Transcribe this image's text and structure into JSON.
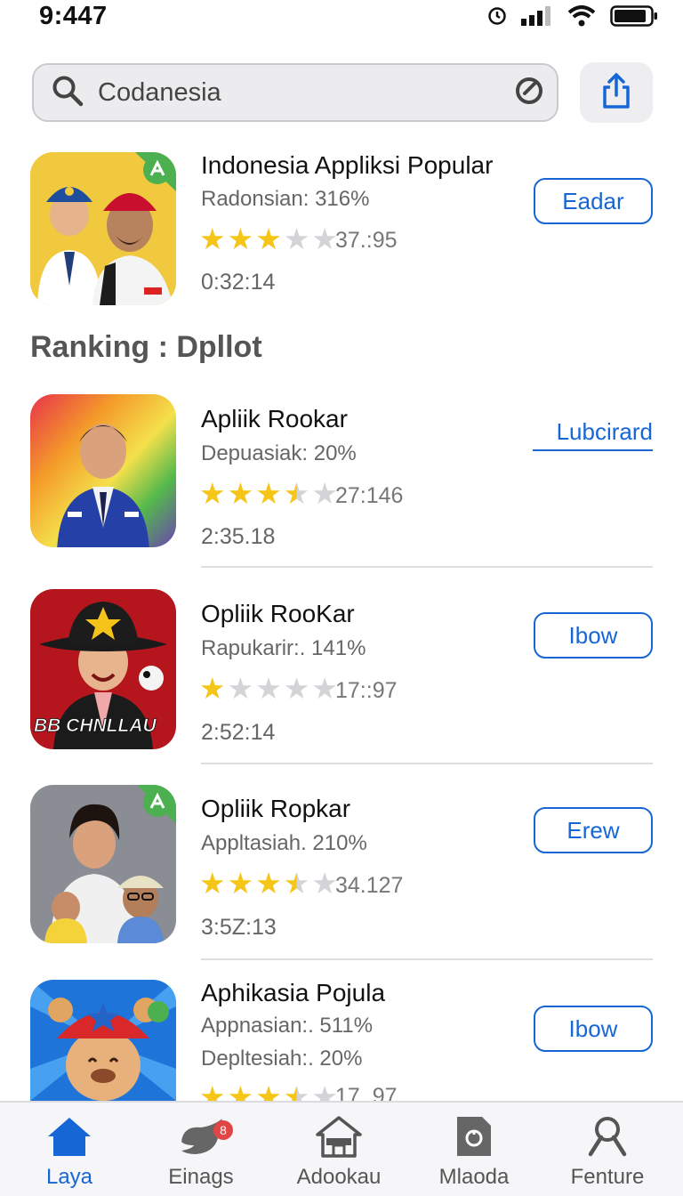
{
  "status_bar": {
    "time": "9:447"
  },
  "search": {
    "query": "Codanesia",
    "icon": "search-icon"
  },
  "featured": {
    "title": "Indonesia Appliksi Popular",
    "subtitle": "Radonsian: 316%",
    "rating_count": "37.:95",
    "time": "0:32:14",
    "stars": 3,
    "button": "Eadar"
  },
  "section": {
    "title": "Ranking  :  Dpllot"
  },
  "apps": [
    {
      "title": "Apliik Rookar",
      "subtitle": "Depuasiak: 20%",
      "rating_count": "27:146",
      "time": "2:35.18",
      "stars": 3.5,
      "button": "Lubcirard",
      "button_style": "link"
    },
    {
      "title": "Opliik RooKar",
      "subtitle": "Rapukarir:. 141%",
      "rating_count": "17::97",
      "time": "2:52:14",
      "stars": 1,
      "button": "Ibow",
      "button_style": "outline",
      "icon_text": "BB CHNLLAU"
    },
    {
      "title": "Opliik Ropkar",
      "subtitle": "Appltasiah. 210%",
      "rating_count": "34.127",
      "time": "3:5Z:13",
      "stars": 3.5,
      "button": "Erew",
      "button_style": "outline"
    },
    {
      "title": "Aphikasia Pojula",
      "subtitle": "Appnasian:. 511%",
      "subtitle2": "Depltesiah:. 20%",
      "rating_count": "17..97",
      "stars": 3.5,
      "button": "Ibow",
      "button_style": "outline"
    }
  ],
  "tab_bar": {
    "tabs": [
      {
        "label": "Laya",
        "icon": "home-icon",
        "active": true
      },
      {
        "label": "Einags",
        "icon": "bird-icon",
        "badge": "8"
      },
      {
        "label": "Adookau",
        "icon": "store-icon"
      },
      {
        "label": "Mlaoda",
        "icon": "document-icon"
      },
      {
        "label": "Fenture",
        "icon": "person-icon"
      }
    ]
  },
  "colors": {
    "accent": "#1666d6",
    "star": "#f5c518",
    "star_empty": "#d4d4d8"
  }
}
